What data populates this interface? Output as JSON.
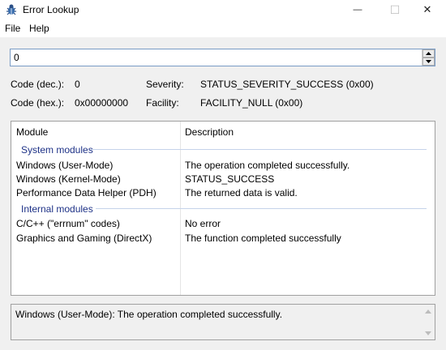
{
  "window": {
    "title": "Error Lookup",
    "icon": "bug-icon",
    "minimize_glyph": "—",
    "maximize_glyph": "☐",
    "close_glyph": "✕"
  },
  "menu": {
    "file": "File",
    "help": "Help"
  },
  "input": {
    "value": "0"
  },
  "info": {
    "code_dec_label": "Code (dec.):",
    "code_dec_value": "0",
    "code_hex_label": "Code (hex.):",
    "code_hex_value": "0x00000000",
    "severity_label": "Severity:",
    "severity_value": "STATUS_SEVERITY_SUCCESS (0x00)",
    "facility_label": "Facility:",
    "facility_value": "FACILITY_NULL (0x00)"
  },
  "list": {
    "columns": [
      "Module",
      "Description"
    ],
    "groups": [
      {
        "name": "System modules",
        "rows": [
          {
            "module": "Windows (User-Mode)",
            "description": "The operation completed successfully."
          },
          {
            "module": "Windows (Kernel-Mode)",
            "description": "STATUS_SUCCESS"
          },
          {
            "module": "Performance Data Helper (PDH)",
            "description": "The returned data is valid."
          }
        ]
      },
      {
        "name": "Internal modules",
        "rows": [
          {
            "module": "C/C++ (\"errnum\" codes)",
            "description": "No error"
          },
          {
            "module": "Graphics and Gaming (DirectX)",
            "description": "The function completed successfully"
          }
        ]
      }
    ]
  },
  "status": {
    "text": "Windows (User-Mode): The operation completed successfully."
  },
  "colors": {
    "accent_group": "#1e3287",
    "input_border": "#7a9cc6"
  }
}
